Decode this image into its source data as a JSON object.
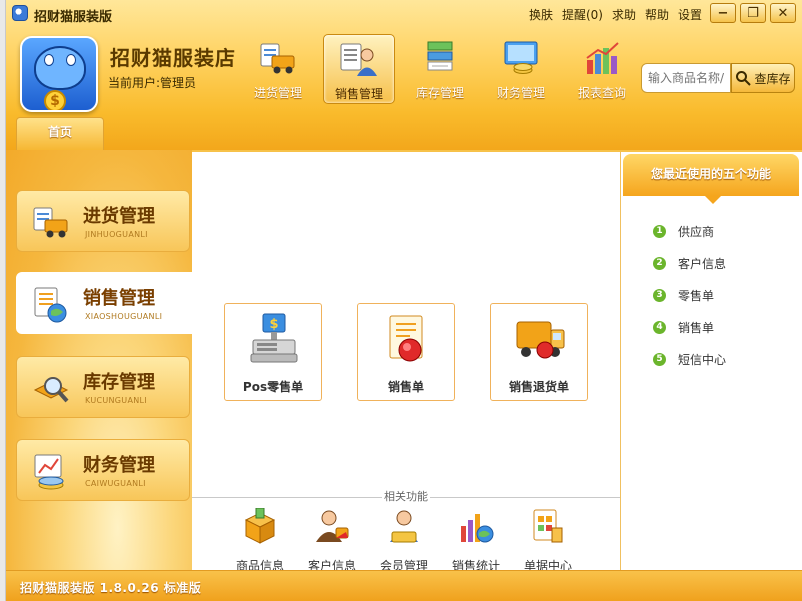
{
  "window": {
    "title": "招财猫服装版",
    "top_links": [
      "换肤",
      "提醒(0)",
      "求助",
      "帮助",
      "设置"
    ],
    "controls": [
      "−",
      "❐",
      "✕"
    ]
  },
  "header": {
    "store_name": "招财猫服装店",
    "current_user": "当前用户:管理员",
    "nav": [
      {
        "label": "进货管理",
        "icon": "truck-icon",
        "active": false
      },
      {
        "label": "销售管理",
        "icon": "sales-person-icon",
        "active": true
      },
      {
        "label": "库存管理",
        "icon": "inventory-icon",
        "active": false
      },
      {
        "label": "财务管理",
        "icon": "finance-monitor-icon",
        "active": false
      },
      {
        "label": "报表查询",
        "icon": "report-chart-icon",
        "active": false
      }
    ],
    "search_placeholder": "输入商品名称/s",
    "search_button": "查库存",
    "home_tab": "首页"
  },
  "modules": [
    {
      "name": "进货管理",
      "pinyin": "JINHUOGUANLI",
      "icon": "truck-icon",
      "active": false
    },
    {
      "name": "销售管理",
      "pinyin": "XIAOSHOUGUANLI",
      "icon": "sales-globe-icon",
      "active": true
    },
    {
      "name": "库存管理",
      "pinyin": "KUCUNGUANLI",
      "icon": "magnifier-box-icon",
      "active": false
    },
    {
      "name": "财务管理",
      "pinyin": "CAIWUGUANLI",
      "icon": "finance-chart-icon",
      "active": false
    }
  ],
  "functions": [
    {
      "label": "Pos零售单",
      "icon": "pos-register-icon"
    },
    {
      "label": "销售单",
      "icon": "sales-order-icon"
    },
    {
      "label": "销售退货单",
      "icon": "return-truck-icon"
    }
  ],
  "related": {
    "title": "相关功能",
    "items": [
      {
        "label": "商品信息",
        "icon": "product-box-icon"
      },
      {
        "label": "客户信息",
        "icon": "customer-icon"
      },
      {
        "label": "会员管理",
        "icon": "member-icon"
      },
      {
        "label": "销售统计",
        "icon": "stats-chart-icon"
      },
      {
        "label": "单据中心",
        "icon": "document-center-icon"
      }
    ]
  },
  "recent": {
    "title": "您最近使用的五个功能",
    "items": [
      "供应商",
      "客户信息",
      "零售单",
      "销售单",
      "短信中心"
    ],
    "numbers": [
      "1",
      "2",
      "3",
      "4",
      "5"
    ]
  },
  "status": {
    "text": "招财猫服装版 1.8.0.26 标准版"
  },
  "colors": {
    "accent": "#f5a51d",
    "header_light": "#ffe79a",
    "badge_green": "#6bb52c",
    "card_border": "#f0b25b"
  }
}
